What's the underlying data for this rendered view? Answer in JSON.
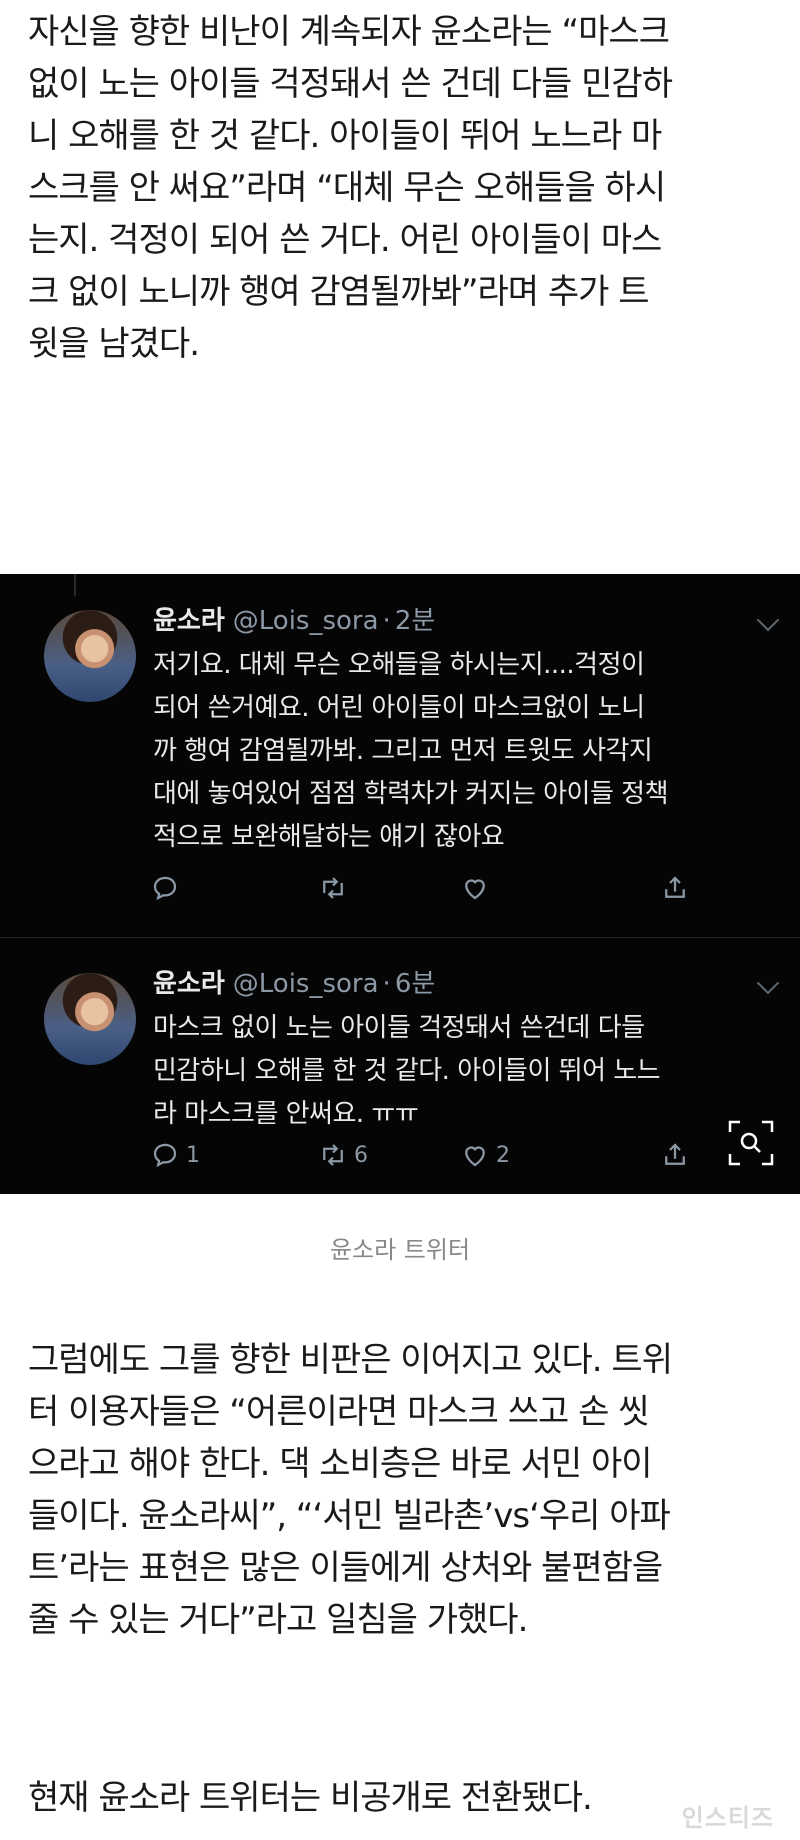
{
  "article": {
    "para1": [
      "자신을 향한 비난이 계속되자 윤소라는 “마스크",
      "없이 노는 아이들 걱정돼서 쓴 건데 다들 민감하",
      "니 오해를 한 것 같다. 아이들이 뛰어 노느라 마",
      "스크를 안 써요”라며 “대체 무슨 오해들을 하시",
      "는지. 걱정이 되어 쓴 거다. 어린 아이들이 마스",
      "크 없이 노니까 행여 감염될까봐”라며 추가 트",
      "윗을 남겼다."
    ],
    "para2": [
      "그럼에도 그를 향한 비판은 이어지고 있다. 트위",
      "터 이용자들은 “어른이라면 마스크 쓰고 손 씻",
      "으라고 해야 한다. 댁 소비층은 바로 서민 아이",
      "들이다. 윤소라씨”, “‘서민 빌라촌’vs‘우리 아파",
      "트’라는 표현은 많은 이들에게 상처와 불편함을",
      "줄 수 있는 거다”라고 일침을 가했다."
    ],
    "para3": [
      "현재 윤소라 트위터는 비공개로 전환됐다."
    ],
    "caption": "윤소라 트위터",
    "watermark": "인스티즈"
  },
  "tweets": [
    {
      "name": "윤소라",
      "handle": "@Lois_sora",
      "sep": "·",
      "time": "2분",
      "lines": [
        "저기요. 대체 무슨 오해들을 하시는지....걱정이",
        "되어 쓴거예요. 어린 아이들이 마스크없이 노니",
        "까 행여 감염될까봐. 그리고 먼저 트윗도 사각지",
        "대에 놓여있어 점점 학력차가 커지는 아이들 정책",
        "적으로 보완해달하는 얘기 잖아요"
      ],
      "replies": "",
      "retweets": "",
      "likes": ""
    },
    {
      "name": "윤소라",
      "handle": "@Lois_sora",
      "sep": "·",
      "time": "6분",
      "lines": [
        "마스크 없이 노는 아이들 걱정돼서 쓴건데 다들",
        "민감하니 오해를 한 것 같다. 아이들이 뛰어 노느",
        "라 마스크를 안써요. ㅠㅠ"
      ],
      "replies": "1",
      "retweets": "6",
      "likes": "2"
    }
  ],
  "icons": {
    "reply": "reply-icon",
    "retweet": "retweet-icon",
    "like": "heart-icon",
    "share": "share-icon",
    "lens": "image-search-icon",
    "more": "chevron-down-icon"
  },
  "colors": {
    "embed_bg": "#050505",
    "tweet_text": "#e7e9ea",
    "muted": "#8b98a5"
  }
}
